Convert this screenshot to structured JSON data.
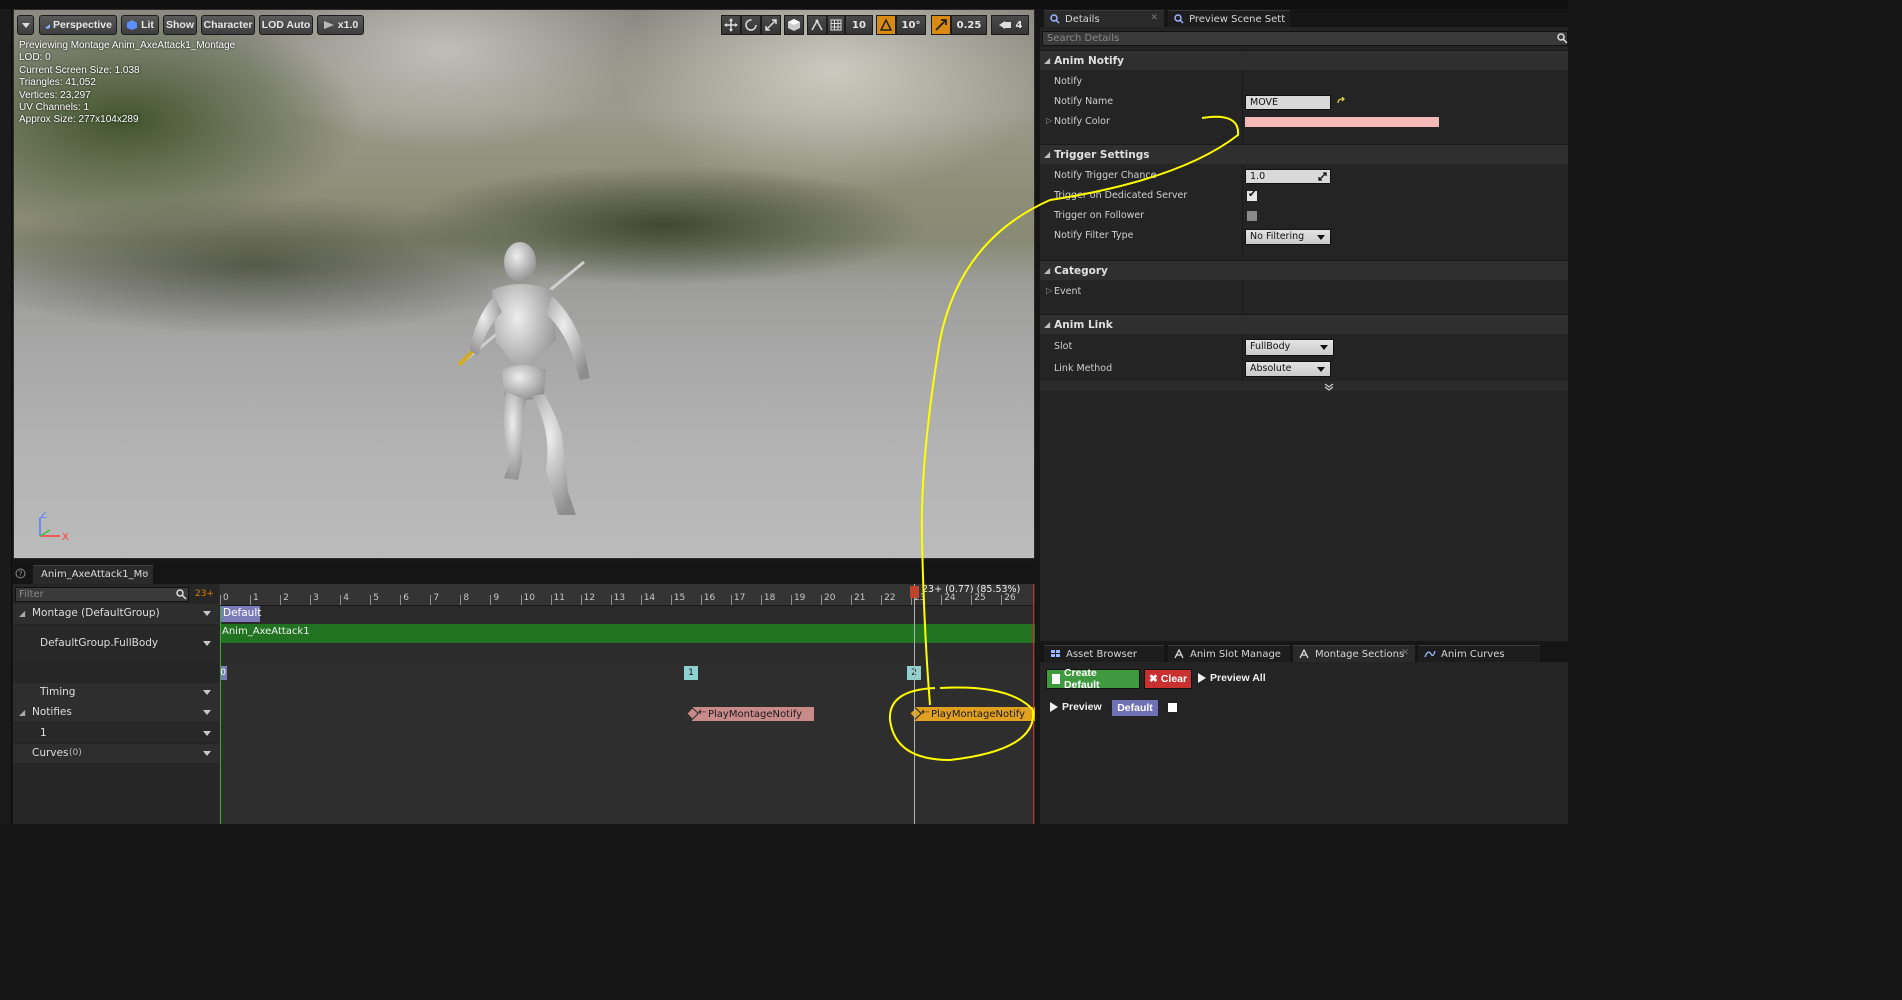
{
  "viewport": {
    "toolbar": {
      "menu_caret": "chevron-down-icon",
      "perspective": "Perspective",
      "lit": "Lit",
      "show": "Show",
      "character": "Character",
      "lod": "LOD Auto",
      "playback_speed": "x1.0",
      "grid_snap": "10",
      "rotation_snap": "10°",
      "scale_snap": "0.25",
      "camera_speed": "4"
    },
    "info_lines": [
      "Previewing Montage Anim_AxeAttack1_Montage",
      "LOD: 0",
      "Current Screen Size: 1.038",
      "Triangles: 41,052",
      "Vertices: 23,297",
      "UV Channels: 1",
      "Approx Size: 277x104x289"
    ],
    "axis": {
      "z": "Z",
      "x": "X"
    }
  },
  "details": {
    "tabs": [
      {
        "label": "Details",
        "icon": "magnifier-icon"
      },
      {
        "label": "Preview Scene Sett",
        "icon": "magnifier-icon"
      }
    ],
    "search_placeholder": "Search Details",
    "sections": {
      "anim_notify": {
        "title": "Anim Notify",
        "notify_label": "Notify",
        "notify_name_label": "Notify Name",
        "notify_name_value": "MOVE",
        "notify_color_label": "Notify Color",
        "notify_color_value": "#f4b9b9"
      },
      "trigger_settings": {
        "title": "Trigger Settings",
        "trigger_chance_label": "Notify Trigger Chance",
        "trigger_chance_value": "1.0",
        "dedicated_server_label": "Trigger on Dedicated Server",
        "dedicated_server_checked": true,
        "follower_label": "Trigger on Follower",
        "follower_checked": false,
        "filter_type_label": "Notify Filter Type",
        "filter_type_value": "No Filtering"
      },
      "category": {
        "title": "Category",
        "event_label": "Event"
      },
      "anim_link": {
        "title": "Anim Link",
        "slot_label": "Slot",
        "slot_value": "FullBody",
        "link_method_label": "Link Method",
        "link_method_value": "Absolute"
      }
    }
  },
  "sections_panel": {
    "tabs": [
      {
        "label": "Asset Browser",
        "icon": "grid-icon"
      },
      {
        "label": "Anim Slot Manage",
        "icon": "slot-icon"
      },
      {
        "label": "Montage Sections",
        "icon": "sections-icon"
      },
      {
        "label": "Anim Curves",
        "icon": "curve-icon"
      }
    ],
    "create_default": "Create Default",
    "clear": "Clear",
    "preview_all": "Preview All",
    "preview": "Preview",
    "default_section": "Default"
  },
  "timeline": {
    "tab_label": "Anim_AxeAttack1_Mo",
    "filter_placeholder": "Filter",
    "frame_indicator": "23+",
    "scrub_label": "23+ (0.77) (85.53%)",
    "tracks": {
      "montage": "Montage (DefaultGroup)",
      "slot": "DefaultGroup.FullBody",
      "timing": "Timing",
      "notifies": "Notifies",
      "notify_track": "1",
      "curves": "Curves",
      "curves_count": "(0)"
    },
    "ruler_ticks": [
      "0",
      "1",
      "2",
      "3",
      "4",
      "5",
      "6",
      "7",
      "8",
      "9",
      "10",
      "11",
      "12",
      "13",
      "14",
      "15",
      "16",
      "17",
      "18",
      "19",
      "20",
      "21",
      "22",
      "23",
      "24",
      "25",
      "26"
    ],
    "default_section": "Default",
    "anim_segment": "Anim_AxeAttack1",
    "timing_markers": [
      "0",
      "1",
      "2"
    ],
    "notifies": [
      {
        "label": "PlayMontageNotify",
        "color": "#c98a8a"
      },
      {
        "label": "PlayMontageNotify",
        "color": "#e0a020"
      }
    ]
  },
  "annotation": {
    "color": "#ffff00"
  }
}
